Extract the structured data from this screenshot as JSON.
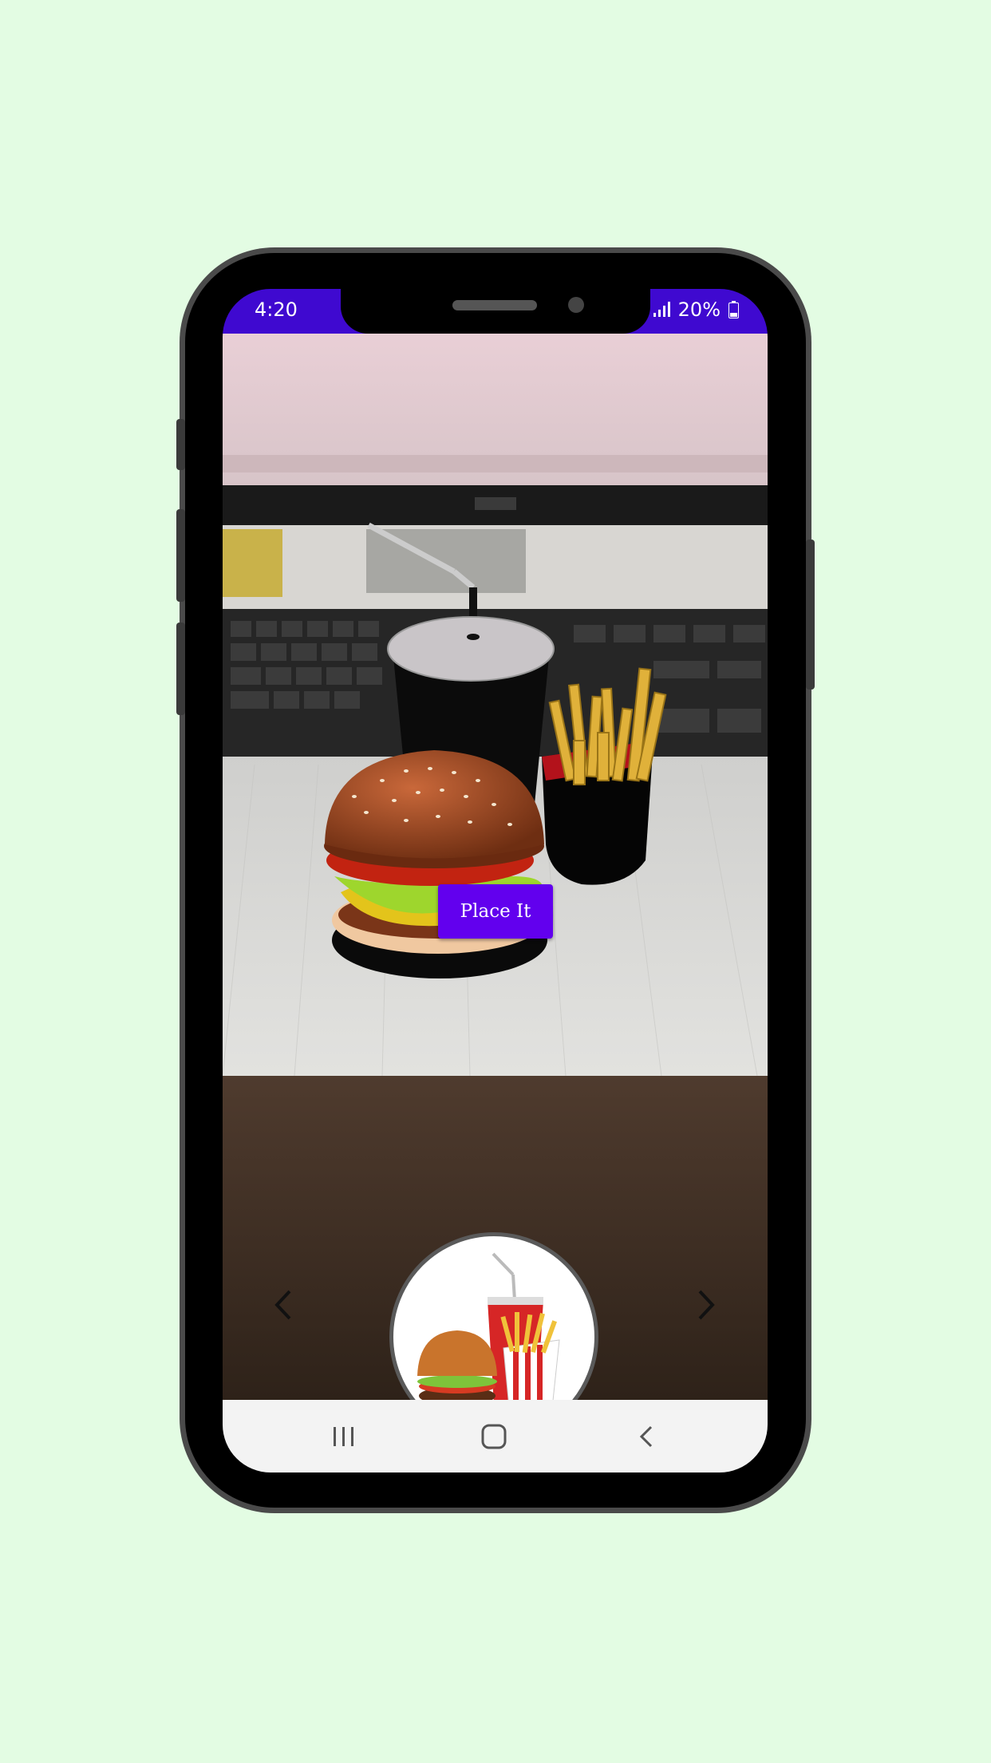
{
  "status": {
    "time": "4:20",
    "battery": "20%"
  },
  "ar": {
    "place_button_label": "Place It"
  },
  "colors": {
    "accent": "#6200ee",
    "status_bar": "#3f09d0",
    "background": "#e3fce3"
  },
  "icons": {
    "prev": "chevron-left-icon",
    "next": "chevron-right-icon",
    "recents": "recents-icon",
    "home": "home-icon",
    "back": "back-icon"
  }
}
